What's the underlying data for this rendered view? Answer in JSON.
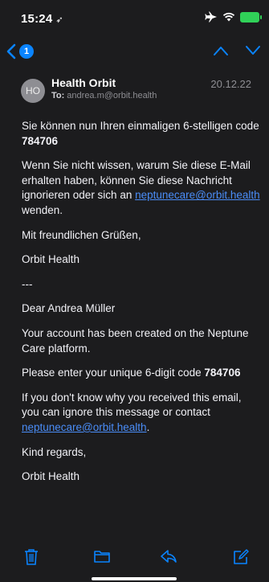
{
  "status": {
    "time": "15:24",
    "location_glyph": "➶"
  },
  "nav": {
    "unread_count": "1"
  },
  "email": {
    "avatar_initials": "HO",
    "sender": "Health Orbit",
    "to_label": "To:",
    "to_address": "andrea.m@orbit.health",
    "date": "20.12.22"
  },
  "body": {
    "de_line1": "Sie können nun Ihren einmaligen 6-stelligen code ",
    "de_code": "784706",
    "de_para2_text": "Wenn Sie nicht wissen, warum Sie diese E-Mail erhalten haben, können Sie diese Nachricht ignorieren oder sich an ",
    "de_para2_link": "neptunecare@orbit.health",
    "de_para2_end": " wenden.",
    "de_greeting": "Mit freundlichen Grüßen,",
    "de_signature": "Orbit Health",
    "separator": "---",
    "en_salutation": "Dear Andrea Müller",
    "en_created": "Your account has been created on the Neptune Care platform.",
    "en_enter_text": "Please enter your unique 6-digit code ",
    "en_code": "784706",
    "en_unknown_text": "If you don't know why you received this email, you can ignore this message or contact ",
    "en_unknown_link": "neptunecare@orbit.health",
    "en_unknown_end": ".",
    "en_regards": "Kind regards,",
    "en_signature": "Orbit Health"
  },
  "colors": {
    "accent": "#0a84ff",
    "background": "#1c1c1e",
    "battery": "#30d158"
  },
  "icons": [
    "location-arrow-icon",
    "airplane-icon",
    "wifi-icon",
    "battery-icon",
    "chevron-left-icon",
    "chevron-up-icon",
    "chevron-down-icon",
    "trash-icon",
    "folder-icon",
    "reply-icon",
    "compose-icon"
  ]
}
